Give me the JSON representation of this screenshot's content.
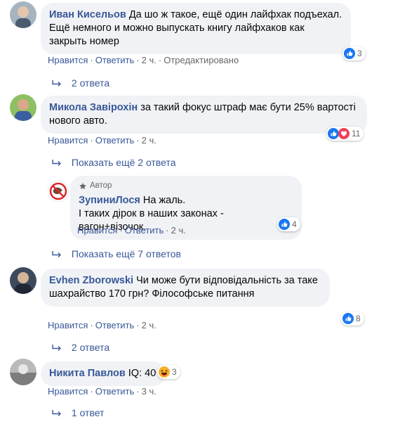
{
  "comments": [
    {
      "author": "Иван Кисельов",
      "text": "Да шо ж такое, ещё один лайфхак подъехал. Ещё немного и можно выпускать книгу лайфхаков как закрыть номер",
      "like": "Нравится",
      "reply": "Ответить",
      "time": "2 ч.",
      "edited": "Отредактировано",
      "reactions": "3",
      "replies_link": "2 ответа"
    },
    {
      "author": "Микола Завірохін",
      "text": "за такий фокус штраф має бути 25% вартості нового авто.",
      "like": "Нравится",
      "reply": "Ответить",
      "time": "2 ч.",
      "reactions": "11",
      "replies_link": "Показать ещё 2 ответа",
      "nested_reply": {
        "author_badge": "Автор",
        "author": "ЗупиниЛося",
        "text_line1": "На жаль.",
        "text_line2": "І таких дірок в наших законах - вагон+візочок.",
        "like": "Нравится",
        "reply": "Ответить",
        "time": "2 ч.",
        "reactions": "4"
      },
      "more_replies_link": "Показать ещё 7 ответов"
    },
    {
      "author": "Evhen Zborowski",
      "text": "Чи може бути відповідальність за таке шахрайство 170 грн? Філософське питання",
      "like": "Нравится",
      "reply": "Ответить",
      "time": "2 ч.",
      "reactions": "8",
      "replies_link": "2 ответа"
    },
    {
      "author": "Никита Павлов",
      "text": "IQ: 40",
      "like": "Нравится",
      "reply": "Ответить",
      "time": "3 ч.",
      "reactions": "3",
      "replies_link": "1 ответ"
    }
  ],
  "colors": {
    "link": "#385898",
    "meta": "#65676b",
    "bubble": "#f0f2f5",
    "like_blue": "#1877f2",
    "love_red": "#f33e58"
  },
  "icons": [
    "like-reaction-icon",
    "love-reaction-icon",
    "haha-reaction-icon",
    "reply-arrow-icon",
    "avatar"
  ]
}
